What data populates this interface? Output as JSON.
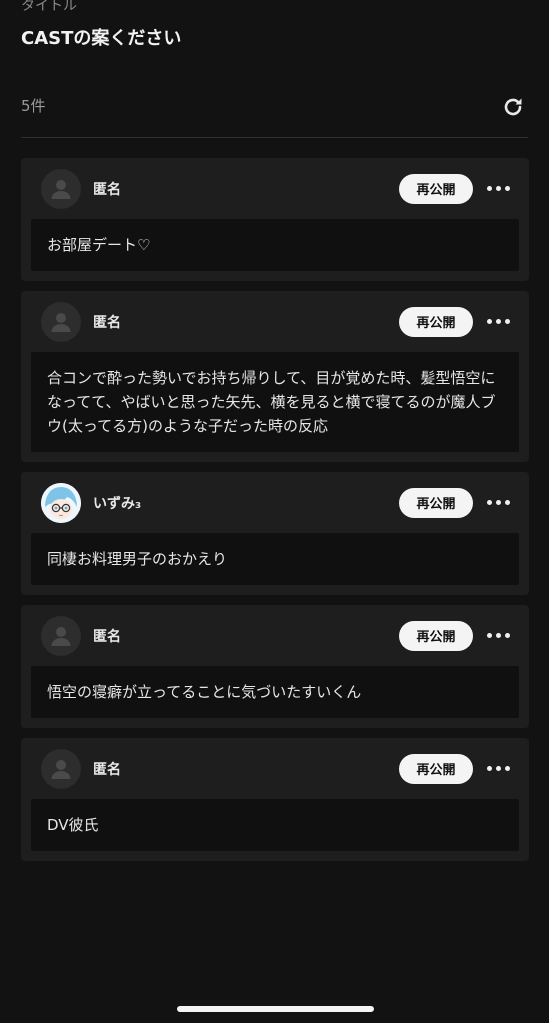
{
  "header": {
    "top_label": "タイトル",
    "title": "CASTの案ください"
  },
  "list_meta": {
    "count": "5件",
    "refresh_icon": "refresh-icon"
  },
  "actions": {
    "republish_label": "再公開",
    "more_icon": "more-horizontal-icon"
  },
  "items": [
    {
      "user": "匿名",
      "avatar": "default-user-icon",
      "text": "お部屋デート♡"
    },
    {
      "user": "匿名",
      "avatar": "default-user-icon",
      "text": "合コンで酔った勢いでお持ち帰りして、目が覚めた時、髪型悟空になってて、やばいと思った矢先、横を見ると横で寝てるのが魔人ブウ(太ってる方)のような子だった時の反応"
    },
    {
      "user": "いずみ₃",
      "avatar": "anime-avatar",
      "text": "同棲お料理男子のおかえり"
    },
    {
      "user": "匿名",
      "avatar": "default-user-icon",
      "text": "悟空の寝癖が立ってることに気づいたすいくん"
    },
    {
      "user": "匿名",
      "avatar": "default-user-icon",
      "text": "DV彼氏"
    }
  ]
}
